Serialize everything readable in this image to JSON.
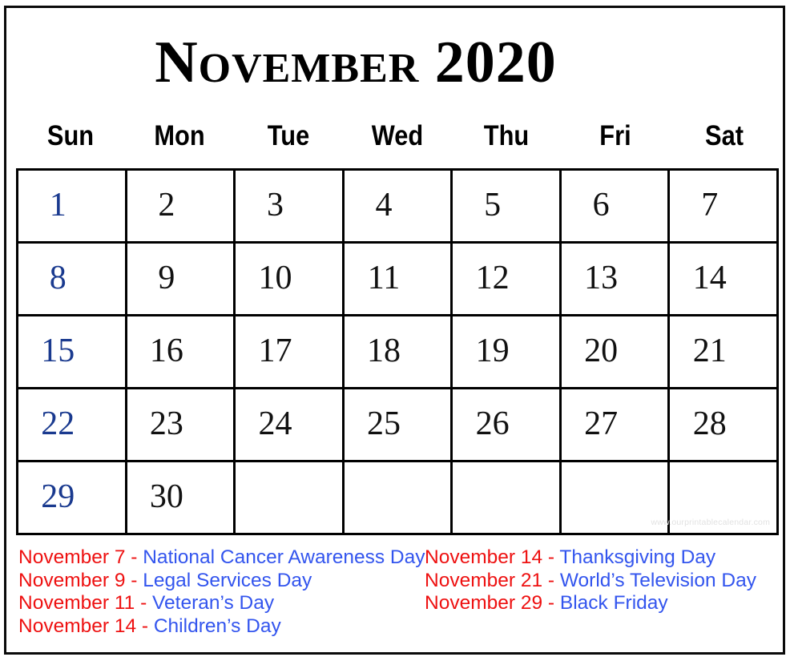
{
  "title": "November 2020",
  "weekdays": [
    "Sun",
    "Mon",
    "Tue",
    "Wed",
    "Thu",
    "Fri",
    "Sat"
  ],
  "colors": {
    "sunday_blue": "#1a3a8f",
    "holiday_date_red": "#ee1111",
    "holiday_name_blue": "#3355ee",
    "grid_border": "#000000",
    "watermark_gray": "#e2e2e2"
  },
  "watermark": "www.ourprintablecalendar.com",
  "weeks": [
    [
      {
        "num": "1",
        "sunday": true
      },
      {
        "num": "2",
        "sunday": false
      },
      {
        "num": "3",
        "sunday": false
      },
      {
        "num": "4",
        "sunday": false
      },
      {
        "num": "5",
        "sunday": false
      },
      {
        "num": "6",
        "sunday": false
      },
      {
        "num": "7",
        "sunday": false
      }
    ],
    [
      {
        "num": "8",
        "sunday": true
      },
      {
        "num": "9",
        "sunday": false
      },
      {
        "num": "10",
        "sunday": false
      },
      {
        "num": "11",
        "sunday": false
      },
      {
        "num": "12",
        "sunday": false
      },
      {
        "num": "13",
        "sunday": false
      },
      {
        "num": "14",
        "sunday": false
      }
    ],
    [
      {
        "num": "15",
        "sunday": true
      },
      {
        "num": "16",
        "sunday": false
      },
      {
        "num": "17",
        "sunday": false
      },
      {
        "num": "18",
        "sunday": false
      },
      {
        "num": "19",
        "sunday": false
      },
      {
        "num": "20",
        "sunday": false
      },
      {
        "num": "21",
        "sunday": false
      }
    ],
    [
      {
        "num": "22",
        "sunday": true
      },
      {
        "num": "23",
        "sunday": false
      },
      {
        "num": "24",
        "sunday": false
      },
      {
        "num": "25",
        "sunday": false
      },
      {
        "num": "26",
        "sunday": false
      },
      {
        "num": "27",
        "sunday": false
      },
      {
        "num": "28",
        "sunday": false
      }
    ],
    [
      {
        "num": "29",
        "sunday": true
      },
      {
        "num": "30",
        "sunday": false
      },
      {
        "num": "",
        "sunday": false
      },
      {
        "num": "",
        "sunday": false
      },
      {
        "num": "",
        "sunday": false
      },
      {
        "num": "",
        "sunday": false
      },
      {
        "num": "",
        "sunday": false
      }
    ]
  ],
  "holidays": {
    "separator": "-",
    "left": [
      {
        "date": "November 7",
        "name": "National Cancer Awareness Day"
      },
      {
        "date": "November 9",
        "name": "Legal Services Day"
      },
      {
        "date": "November 11",
        "name": "Veteran’s Day"
      },
      {
        "date": "November 14",
        "name": "Children’s Day"
      }
    ],
    "right": [
      {
        "date": "November 14",
        "name": "Thanksgiving Day"
      },
      {
        "date": "November 21",
        "name": "World’s Television Day"
      },
      {
        "date": "November 29",
        "name": "Black Friday"
      }
    ]
  }
}
